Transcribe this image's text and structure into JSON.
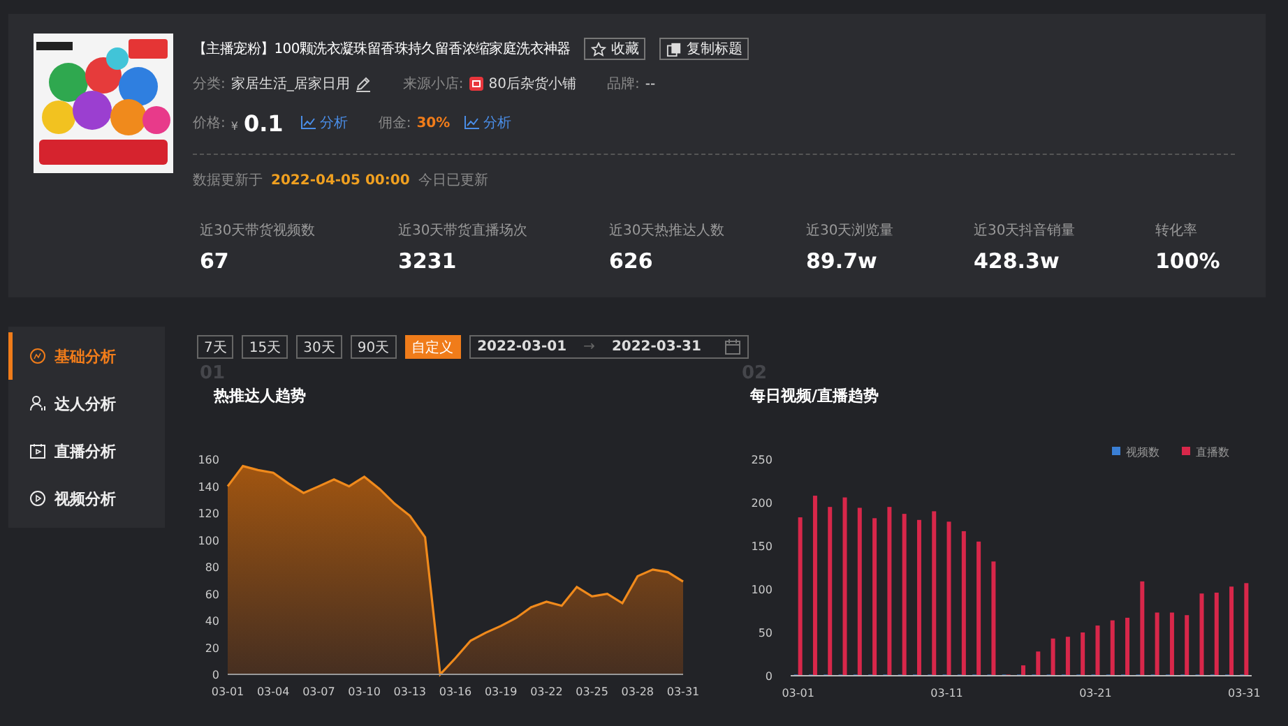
{
  "product": {
    "title": "【主播宠粉】100颗洗衣凝珠留香珠持久留香浓缩家庭洗衣神器",
    "actions": [
      {
        "kind": "favorite",
        "label": "收藏"
      },
      {
        "kind": "copy",
        "label": "复制标题"
      }
    ],
    "category_label": "分类:",
    "category": "家居生活_居家日用",
    "shop_label": "来源小店:",
    "shop": "80后杂货小铺",
    "brand_label": "品牌:",
    "brand": "--",
    "price_label": "价格:",
    "currency": "¥",
    "price": "0.1",
    "price_analyze": "分析",
    "commission_label": "佣金:",
    "commission": "30%",
    "commission_analyze": "分析"
  },
  "update": {
    "label": "数据更新于",
    "time": "2022-04-05 00:00",
    "note": "今日已更新"
  },
  "stats": [
    {
      "label": "近30天带货视频数",
      "value": "67"
    },
    {
      "label": "近30天带货直播场次",
      "value": "3231"
    },
    {
      "label": "近30天热推达人数",
      "value": "626"
    },
    {
      "label": "近30天浏览量",
      "value": "89.7w"
    },
    {
      "label": "近30天抖音销量",
      "value": "428.3w"
    },
    {
      "label": "转化率",
      "value": "100%"
    }
  ],
  "sidebar": [
    {
      "kind": "basic",
      "label": "基础分析",
      "selected": true
    },
    {
      "kind": "talent",
      "label": "达人分析",
      "selected": false
    },
    {
      "kind": "live",
      "label": "直播分析",
      "selected": false
    },
    {
      "kind": "video",
      "label": "视频分析",
      "selected": false
    }
  ],
  "ranges": [
    {
      "label": "7天",
      "selected": false
    },
    {
      "label": "15天",
      "selected": false
    },
    {
      "label": "30天",
      "selected": false
    },
    {
      "label": "90天",
      "selected": false
    },
    {
      "label": "自定义",
      "selected": true
    }
  ],
  "date_range": {
    "from": "2022-03-01",
    "separator": "→",
    "to": "2022-03-31"
  },
  "charts": [
    {
      "number": "01",
      "chart_data": {
        "type": "area",
        "title": "热推达人趋势",
        "categories": [
          "03-01",
          null,
          null,
          "03-04",
          null,
          null,
          "03-07",
          null,
          null,
          "03-10",
          null,
          null,
          "03-13",
          null,
          null,
          "03-16",
          null,
          null,
          "03-19",
          null,
          null,
          "03-22",
          null,
          null,
          "03-25",
          null,
          null,
          "03-28",
          null,
          null,
          "03-31"
        ],
        "series": [
          {
            "color": "#f08a1c",
            "values": [
              140,
              155,
              152,
              150,
              142,
              135,
              140,
              145,
              140,
              147,
              138,
              127,
              118,
              102,
              0,
              12,
              25,
              31,
              36,
              42,
              50,
              54,
              51,
              65,
              58,
              60,
              53,
              73,
              78,
              76,
              69
            ]
          }
        ],
        "ylim": [
          0,
          160
        ],
        "yticks": [
          0,
          20,
          40,
          60,
          80,
          100,
          120,
          140,
          160
        ]
      }
    },
    {
      "number": "02",
      "chart_data": {
        "type": "bar",
        "title": "每日视频/直播趋势",
        "legend": "top-right",
        "categories": [
          "03-01",
          null,
          null,
          null,
          null,
          null,
          null,
          null,
          null,
          null,
          "03-11",
          null,
          null,
          null,
          null,
          null,
          null,
          null,
          null,
          null,
          "03-21",
          null,
          null,
          null,
          null,
          null,
          null,
          null,
          null,
          null,
          "03-31"
        ],
        "series": [
          {
            "name": "视频数",
            "color": "#3a7fd5",
            "values": [
              0,
              0,
              0,
              0,
              0,
              0,
              0,
              0,
              0,
              0,
              0,
              0,
              0,
              0,
              0,
              0,
              0,
              0,
              0,
              0,
              0,
              0,
              0,
              0,
              0,
              0,
              0,
              0,
              0,
              0,
              0
            ]
          },
          {
            "name": "直播数",
            "color": "#d8274a",
            "values": [
              183,
              208,
              195,
              206,
              194,
              182,
              195,
              187,
              180,
              190,
              178,
              167,
              155,
              132,
              0,
              12,
              28,
              43,
              45,
              50,
              58,
              64,
              67,
              109,
              73,
              73,
              70,
              95,
              96,
              103,
              107
            ]
          }
        ],
        "ylim": [
          0,
          250
        ],
        "yticks": [
          0,
          50,
          100,
          150,
          200,
          250
        ]
      }
    }
  ]
}
